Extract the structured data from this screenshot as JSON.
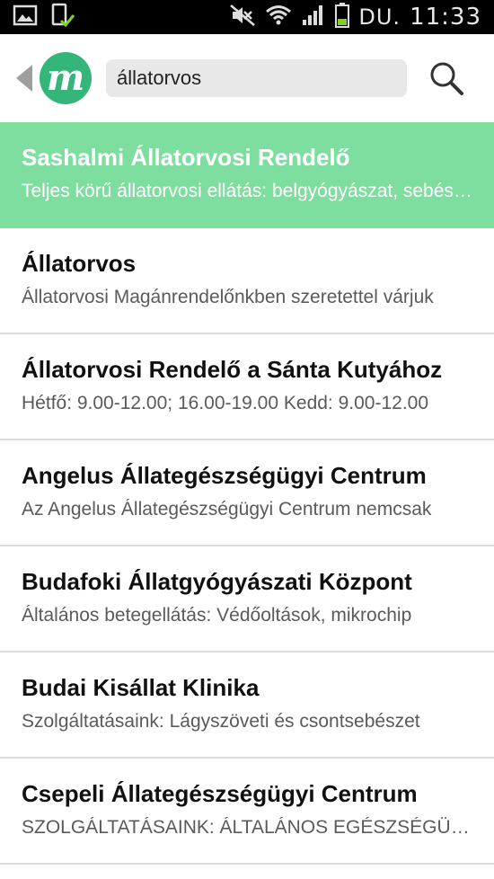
{
  "status_bar": {
    "ampm": "DU.",
    "time": "11:33"
  },
  "search": {
    "query": "állatorvos"
  },
  "results": [
    {
      "title": "Sashalmi Állatorvosi Rendelő",
      "subtitle": "Teljes körű állatorvosi ellátás: belgyógyászat, sebészet"
    },
    {
      "title": "Állatorvos",
      "subtitle": "Állatorvosi Magánrendelőnkben szeretettel várjuk"
    },
    {
      "title": "Állatorvosi Rendelő a Sánta Kutyához",
      "subtitle": "Hétfő: 9.00-12.00; 16.00-19.00 Kedd: 9.00-12.00"
    },
    {
      "title": "Angelus Állategészségügyi Centrum",
      "subtitle": "Az Angelus Állategészségügyi Centrum nemcsak"
    },
    {
      "title": "Budafoki Állatgyógyászati Központ",
      "subtitle": "Általános betegellátás: Védőoltások, mikrochip"
    },
    {
      "title": "Budai Kisállat Klinika",
      "subtitle": "Szolgáltatásaink: Lágyszöveti és csontsebészet"
    },
    {
      "title": "Csepeli Állategészségügyi Centrum",
      "subtitle": "SZOLGÁLTATÁSAINK: ÁLTALÁNOS EGÉSZSÉGÜGYI"
    }
  ],
  "colors": {
    "accent": "#34b67b",
    "selected_row": "#7ede9f"
  }
}
